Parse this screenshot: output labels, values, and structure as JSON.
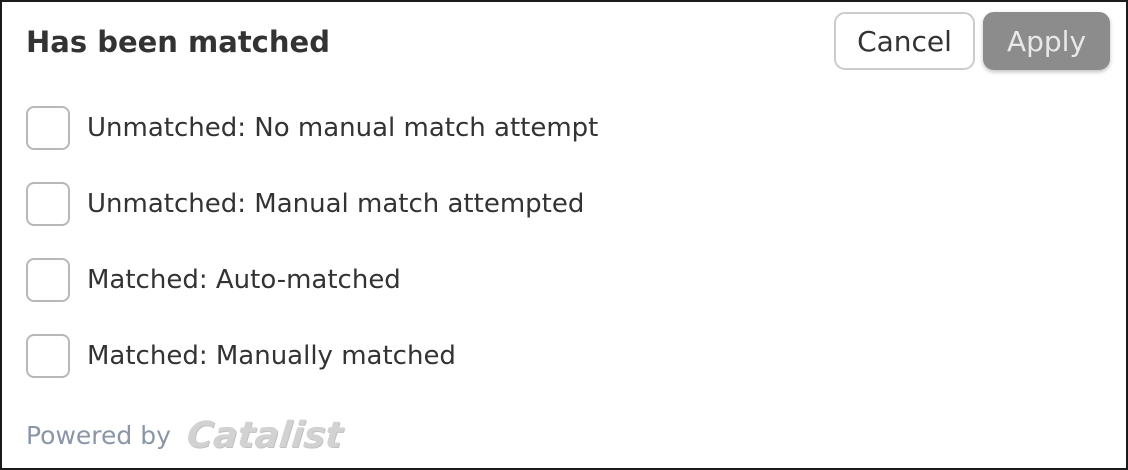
{
  "header": {
    "title": "Has been matched",
    "cancel_label": "Cancel",
    "apply_label": "Apply"
  },
  "options": [
    {
      "label": "Unmatched: No manual match attempt",
      "checked": false
    },
    {
      "label": "Unmatched: Manual match attempted",
      "checked": false
    },
    {
      "label": "Matched: Auto-matched",
      "checked": false
    },
    {
      "label": "Matched: Manually matched",
      "checked": false
    }
  ],
  "footer": {
    "powered_by": "Powered by",
    "brand": "Catalist"
  },
  "colors": {
    "apply_disabled_bg": "#8c8c8c",
    "text": "#333333",
    "powered_by_text": "#8a96a8",
    "checkbox_border": "#b8b8b8"
  }
}
